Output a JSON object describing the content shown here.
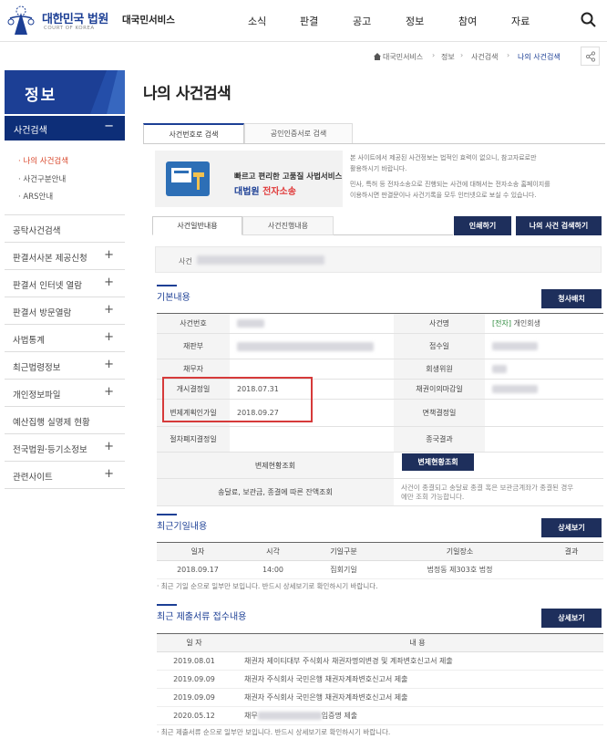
{
  "header": {
    "logo_title": "대한민국 법원",
    "logo_sub": "COURT OF KOREA",
    "service_name": "대국민서비스",
    "nav": [
      "소식",
      "판결",
      "공고",
      "정보",
      "참여",
      "자료"
    ]
  },
  "breadcrumb": [
    "대국민서비스",
    "정보",
    "사건검색",
    "나의 사건검색"
  ],
  "sidebar": {
    "title": "정보",
    "active": {
      "label": "사건검색",
      "toggle": "−"
    },
    "subs": [
      "· 나의 사건검색",
      "· 사건구분안내",
      "· ARS안내"
    ],
    "items": [
      "공탁사건검색",
      "판결서사본 제공신청",
      "판결서 인터넷 열람",
      "판결서 방문열람",
      "사법통계",
      "최근법령정보",
      "개인정보파일",
      "예산집행 실명제 현황",
      "전국법원·등기소정보",
      "관련사이트"
    ],
    "plus": [
      "",
      "+",
      "+",
      "+",
      "+",
      "+",
      "+",
      "",
      "+",
      "+"
    ]
  },
  "page_title": "나의 사건검색",
  "tabs": [
    "사건번호로 검색",
    "공인인증서로 검색"
  ],
  "banner": {
    "line1": "빠르고 편리한 고품질 사법서비스",
    "line2_a": "대법원 ",
    "line2_b": "전자소송"
  },
  "notice_lines": [
    "본 사이트에서 제공된 사건정보는 법적인 효력이 없으니, 참고자료로만",
    "활용하시기 바랍니다.",
    "민사, 특허 등 전자소송으로 진행되는 사건에 대해서는 전자소송 홈페이지를",
    "이용하시면 판결문이나 사건기록을 모두 인터넷으로 보실 수 있습니다."
  ],
  "subtabs": [
    "사건일반내용",
    "사건진행내용"
  ],
  "buttons": {
    "print": "인쇄하기",
    "my_search": "나의 사건 검색하기",
    "bankruptcy": "청사배치",
    "repayment": "변제현황조회",
    "detail1": "상세보기",
    "detail2": "상세보기"
  },
  "case_label": "사건",
  "basic": {
    "title": "기본내용",
    "labels": {
      "case_no": "사건번호",
      "case_name": "사건명",
      "court": "재판부",
      "receipt": "접수일",
      "debtor": "채무자",
      "committee": "회생위원",
      "start_date": "개시결정일",
      "objection": "채권이의마감일",
      "plan_approval": "변제계획인가일",
      "discharge": "면책결정일",
      "abolish": "절차폐지결정일",
      "final": "종국결과",
      "repay_inquiry": "변제현황조회",
      "refund_inquiry": "송달료, 보관금, 종결에 따른 잔액조회"
    },
    "case_name_tag": "[전자]",
    "case_name_text": " 개인회생",
    "start_date": "2018.07.31",
    "plan_approval_date": "2018.09.27",
    "refund_note_1": "사건이 종결되고 송달료 종결 혹은 보관금계좌가 종결된 경우",
    "refund_note_2": "에만 조회 가능합니다."
  },
  "recent_dates": {
    "title": "최근기일내용",
    "headers": [
      "일자",
      "시각",
      "기일구분",
      "기일장소",
      "결과"
    ],
    "rows": [
      [
        "2018.09.17",
        "14:00",
        "집회기일",
        "법정동 제303호 법정",
        ""
      ]
    ],
    "note": "· 최근 기일 순으로 일부만 보입니다. 반드시 상세보기로 확인하시기 바랍니다."
  },
  "recent_docs": {
    "title": "최근 제출서류 접수내용",
    "headers": [
      "일 자",
      "내 용"
    ],
    "rows": [
      [
        "2019.08.01",
        "채권자 제이티대부 주식회사 채권자명의변경 및 계좌변호신고서 제출"
      ],
      [
        "2019.09.09",
        "채권자 주식회사 국민은행 채권자계좌변호신고서 제출"
      ],
      [
        "2019.09.09",
        "채권자 주식회사 국민은행 채권자계좌변호신고서 제출"
      ],
      [
        "2020.05.12",
        "채무"
      ]
    ],
    "row4_tail": "입증명 제출",
    "note": "· 최근 제출서류 순으로 일부만 보입니다. 반드시 상세보기로 확인하시기 바랍니다."
  }
}
